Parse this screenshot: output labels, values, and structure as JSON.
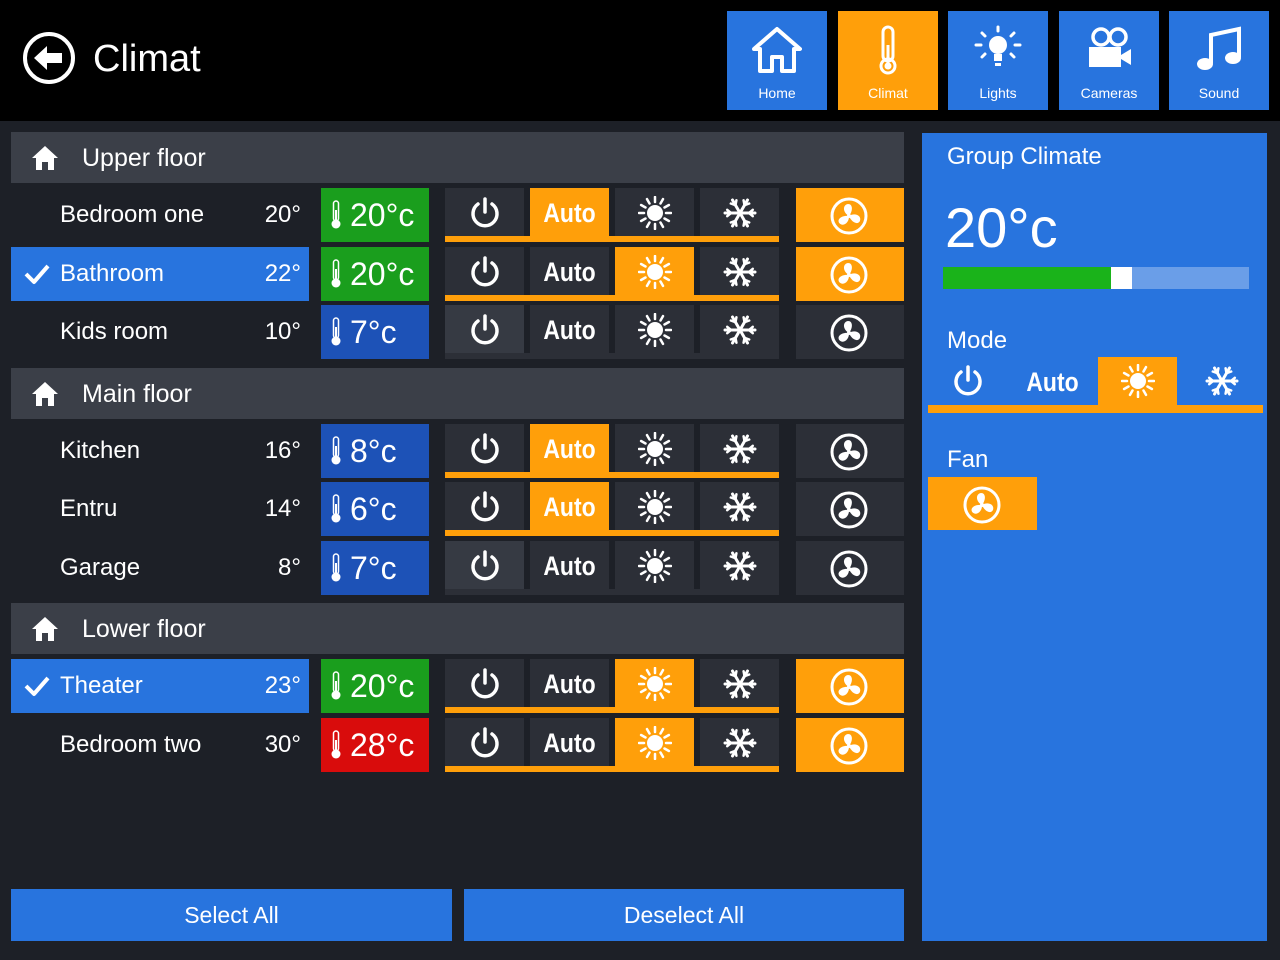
{
  "header": {
    "title": "Climat",
    "nav": [
      {
        "label": "Home",
        "icon": "home-icon",
        "active": false
      },
      {
        "label": "Climat",
        "icon": "thermometer-icon",
        "active": true
      },
      {
        "label": "Lights",
        "icon": "lightbulb-icon",
        "active": false
      },
      {
        "label": "Cameras",
        "icon": "camera-icon",
        "active": false
      },
      {
        "label": "Sound",
        "icon": "music-note-icon",
        "active": false
      }
    ]
  },
  "floors": [
    {
      "name": "Upper floor",
      "rooms": [
        {
          "name": "Bedroom one",
          "current": "20°",
          "setpoint": "20°c",
          "setpoint_color": "#1a9e1d",
          "selected": false,
          "mode": "auto",
          "mode_enabled": true,
          "fan_on": true
        },
        {
          "name": "Bathroom",
          "current": "22°",
          "setpoint": "20°c",
          "setpoint_color": "#1a9e1d",
          "selected": true,
          "mode": "heat",
          "mode_enabled": true,
          "fan_on": true
        },
        {
          "name": "Kids room",
          "current": "10°",
          "setpoint": "7°c",
          "setpoint_color": "#1d52b7",
          "selected": false,
          "mode": "off",
          "mode_enabled": false,
          "fan_on": false
        }
      ]
    },
    {
      "name": "Main floor",
      "rooms": [
        {
          "name": "Kitchen",
          "current": "16°",
          "setpoint": "8°c",
          "setpoint_color": "#1d52b7",
          "selected": false,
          "mode": "auto",
          "mode_enabled": true,
          "fan_on": false
        },
        {
          "name": "Entru",
          "current": "14°",
          "setpoint": "6°c",
          "setpoint_color": "#1d52b7",
          "selected": false,
          "mode": "auto",
          "mode_enabled": true,
          "fan_on": false
        },
        {
          "name": "Garage",
          "current": "8°",
          "setpoint": "7°c",
          "setpoint_color": "#1d52b7",
          "selected": false,
          "mode": "off",
          "mode_enabled": false,
          "fan_on": false
        }
      ]
    },
    {
      "name": "Lower floor",
      "rooms": [
        {
          "name": "Theater",
          "current": "23°",
          "setpoint": "20°c",
          "setpoint_color": "#1a9e1d",
          "selected": true,
          "mode": "heat",
          "mode_enabled": true,
          "fan_on": true
        },
        {
          "name": "Bedroom two",
          "current": "30°",
          "setpoint": "28°c",
          "setpoint_color": "#d90c0c",
          "selected": false,
          "mode": "heat",
          "mode_enabled": true,
          "fan_on": true
        }
      ]
    }
  ],
  "mode_auto_label": "Auto",
  "buttons": {
    "select_all": "Select All",
    "deselect_all": "Deselect All"
  },
  "group": {
    "title": "Group Climate",
    "temperature": "20°c",
    "slider_fraction": 0.55,
    "mode_label": "Mode",
    "mode": "heat",
    "fan_label": "Fan",
    "fan_on": true
  },
  "colors": {
    "accent_blue": "#2874de",
    "active_orange": "#ff9f0a",
    "header_black": "#000000",
    "background": "#1d2027"
  }
}
